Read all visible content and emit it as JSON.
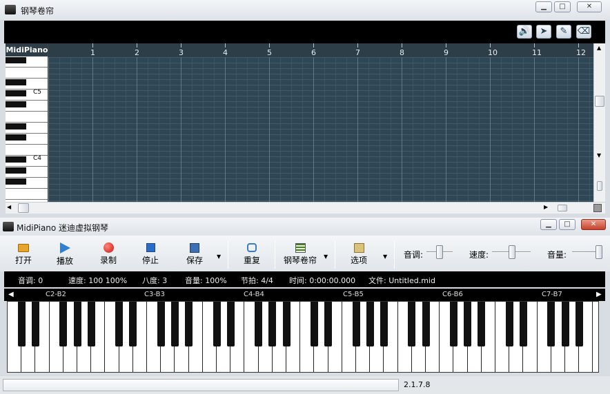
{
  "roll_window": {
    "title": "钢琴卷帘",
    "keyboard_label": "MidiPiano",
    "octave_labels": [
      "C5",
      "C4"
    ],
    "measures": [
      "1",
      "2",
      "3",
      "4",
      "5",
      "6",
      "7",
      "8",
      "9",
      "10",
      "11",
      "12"
    ],
    "tools": [
      {
        "name": "speaker-icon",
        "glyph": "🔊"
      },
      {
        "name": "select-cursor-icon",
        "glyph": "➤"
      },
      {
        "name": "pencil-icon",
        "glyph": "✎"
      },
      {
        "name": "eraser-icon",
        "glyph": "⌫"
      }
    ]
  },
  "main_window": {
    "title": "MidiPiano 迷迪虚拟钢琴",
    "toolbar": {
      "open": "打开",
      "play": "播放",
      "record": "录制",
      "stop": "停止",
      "save": "保存",
      "repeat": "重复",
      "piano_roll": "钢琴卷帘",
      "options": "选项",
      "pitch_label": "音调:",
      "speed_label": "速度:",
      "volume_label": "音量:"
    },
    "status": {
      "pitch": "音调:  0",
      "speed": "速度:  100  100%",
      "octave": "八度:  3",
      "volume": "音量:  100%",
      "beat": "节拍:  4/4",
      "time": "时间:  0:00:00.000",
      "file": "文件:  Untitled.mid"
    },
    "octave_ranges": [
      "C2-B2",
      "C3-B3",
      "C4-B4",
      "C5-B5",
      "C6-B6",
      "C7-B7"
    ],
    "version": "2.1.7.8"
  },
  "colors": {
    "grid_bg": "#2f4654",
    "ruler_bg": "#2d3e48",
    "status_bg": "#000000",
    "play": "#2f7fd3",
    "record": "#d42020",
    "stop": "#2a6cc8"
  }
}
